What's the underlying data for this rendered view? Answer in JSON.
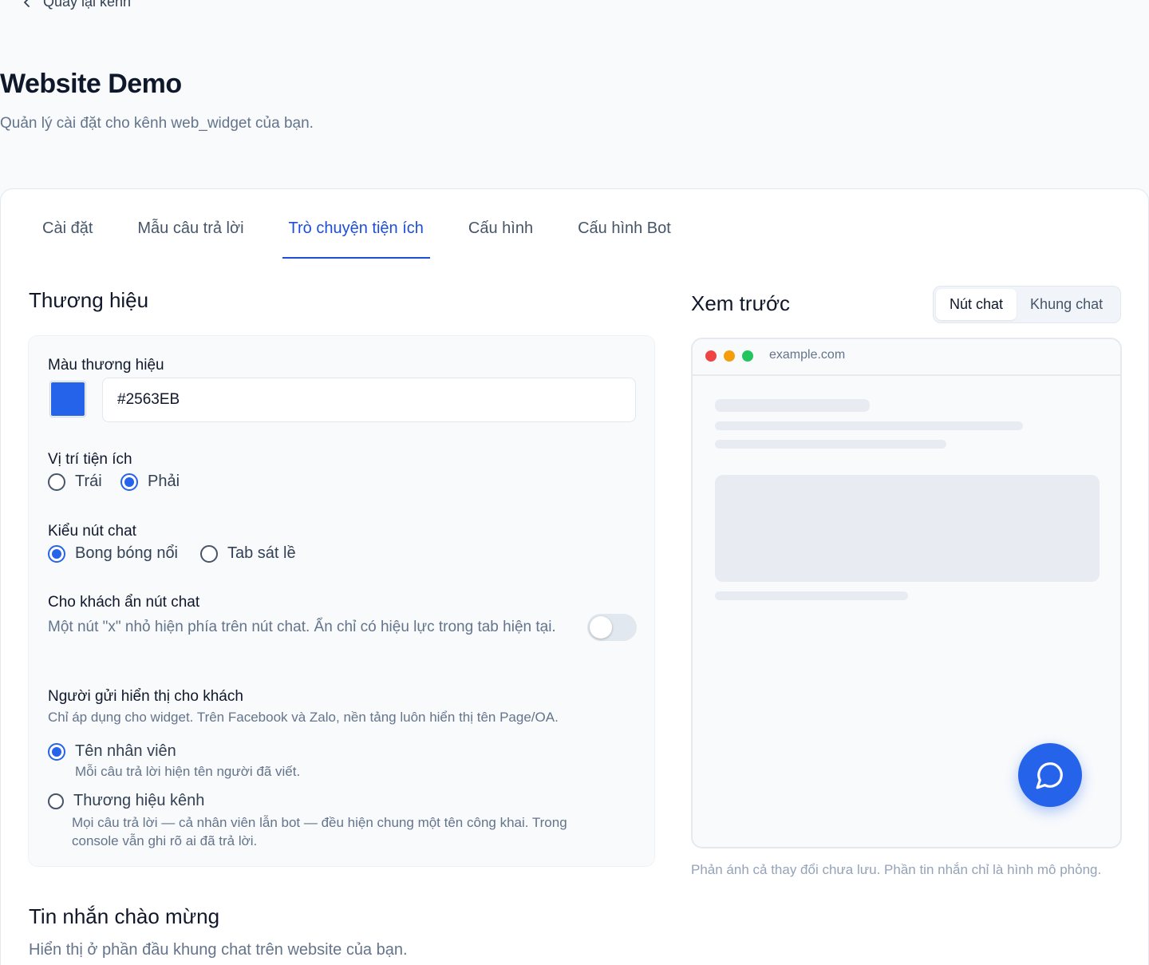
{
  "header": {
    "back_label": "Quay lại kênh",
    "title": "Website Demo",
    "subtitle": "Quản lý cài đặt cho kênh web_widget của bạn."
  },
  "tabs": [
    {
      "label": "Cài đặt",
      "active": false
    },
    {
      "label": "Mẫu câu trả lời",
      "active": false
    },
    {
      "label": "Trò chuyện tiện ích",
      "active": true
    },
    {
      "label": "Cấu hình",
      "active": false
    },
    {
      "label": "Cấu hình Bot",
      "active": false
    }
  ],
  "branding": {
    "section_title": "Thương hiệu",
    "color_label": "Màu thương hiệu",
    "color_value": "#2563EB",
    "swatch_color": "#2563eb",
    "position": {
      "label": "Vị trí tiện ích",
      "options": [
        {
          "label": "Trái",
          "selected": false
        },
        {
          "label": "Phải",
          "selected": true
        }
      ]
    },
    "button_style": {
      "label": "Kiểu nút chat",
      "options": [
        {
          "label": "Bong bóng nổi",
          "selected": true
        },
        {
          "label": "Tab sát lề",
          "selected": false
        }
      ]
    },
    "hide_button": {
      "label": "Cho khách ẩn nút chat",
      "description": "Một nút \"x\" nhỏ hiện phía trên nút chat. Ẩn chỉ có hiệu lực trong tab hiện tại.",
      "enabled": false
    },
    "sender": {
      "label": "Người gửi hiển thị cho khách",
      "description": "Chỉ áp dụng cho widget. Trên Facebook và Zalo, nền tảng luôn hiển thị tên Page/OA.",
      "options": [
        {
          "label": "Tên nhân viên",
          "description": "Mỗi câu trả lời hiện tên người đã viết.",
          "selected": true
        },
        {
          "label": "Thương hiệu kênh",
          "description": "Mọi câu trả lời — cả nhân viên lẫn bot — đều hiện chung một tên công khai. Trong console vẫn ghi rõ ai đã trả lời.",
          "selected": false
        }
      ]
    }
  },
  "preview": {
    "title": "Xem trước",
    "modes": [
      {
        "label": "Nút chat",
        "active": true
      },
      {
        "label": "Khung chat",
        "active": false
      }
    ],
    "url": "example.com",
    "window_dot_colors": [
      "#ef4444",
      "#f59e0b",
      "#22c55e"
    ],
    "fab_color": "#2563eb",
    "fab_icon": "chat-bubble-icon",
    "note": "Phản ánh cả thay đổi chưa lưu. Phần tin nhắn chỉ là hình mô phỏng."
  },
  "welcome": {
    "title": "Tin nhắn chào mừng",
    "subtitle": "Hiển thị ở phần đầu khung chat trên website của bạn."
  }
}
